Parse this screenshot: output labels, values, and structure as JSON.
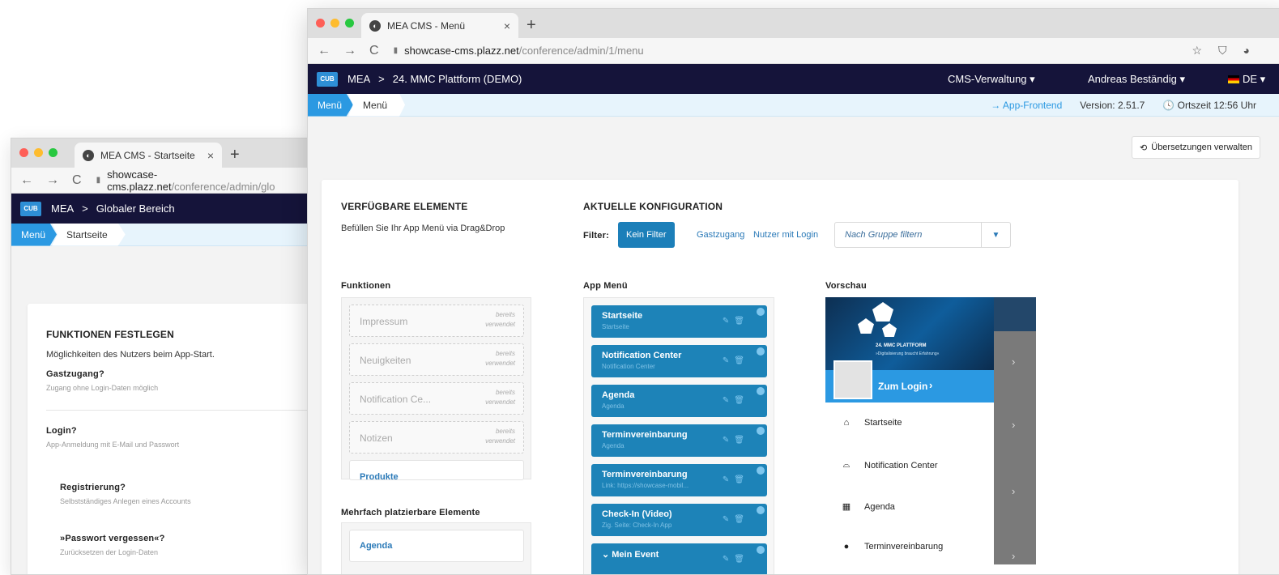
{
  "back_window": {
    "tab_title": "MEA CMS - Startseite",
    "url_host": "showcase-cms.plazz.net",
    "url_path": "/conference/admin/glo",
    "app": {
      "logo": "CUB",
      "crumb_root": "MEA",
      "crumb_sep": ">",
      "crumb_current": "Globaler Bereich"
    },
    "breadcrumb": {
      "active": "Menü",
      "item": "Startseite"
    },
    "section_title": "FUNKTIONEN FESTLEGEN",
    "section_desc": "Möglichkeiten des Nutzers beim App-Start.",
    "options": [
      {
        "label": "Gastzugang?",
        "desc": "Zugang ohne Login-Daten möglich"
      },
      {
        "label": "Login?",
        "desc": "App-Anmeldung mit E-Mail und Passwort"
      },
      {
        "label": "Registrierung?",
        "desc": "Selbstständiges Anlegen eines Accounts"
      },
      {
        "label": "»Passwort vergessen«?",
        "desc": "Zurücksetzen der Login-Daten"
      }
    ]
  },
  "front_window": {
    "tab_title": "MEA CMS - Menü",
    "url_host": "showcase-cms.plazz.net",
    "url_path": "/conference/admin/1/menu",
    "app": {
      "logo": "CUB",
      "crumb_root": "MEA",
      "crumb_sep": ">",
      "crumb_current": "24. MMC Plattform (DEMO)",
      "cms_menu": "CMS-Verwaltung ▾",
      "user_menu": "Andreas Beständig ▾",
      "lang": "DE ▾"
    },
    "breadcrumb": {
      "active": "Menü",
      "item": "Menü",
      "frontend_link": "→ App-Frontend",
      "version": "Version: 2.51.7",
      "time": "🕓 Ortszeit 12:56 Uhr"
    },
    "translations_button": "Übersetzungen verwalten",
    "available": {
      "title": "VERFÜGBARE ELEMENTE",
      "desc": "Befüllen Sie Ihr App Menü via Drag&Drop"
    },
    "config": {
      "title": "AKTUELLE KONFIGURATION",
      "filter_label": "Filter:",
      "filter_active": "Kein Filter",
      "filter_guest": "Gastzugang",
      "filter_login": "Nutzer mit Login",
      "group_placeholder": "Nach Gruppe filtern"
    },
    "functions": {
      "title": "Funktionen",
      "used_line1": "bereits",
      "used_line2": "verwendet",
      "items": [
        "Impressum",
        "Neuigkeiten",
        "Notification Ce...",
        "Notizen"
      ],
      "extra_item": "Produkte"
    },
    "multi": {
      "title": "Mehrfach platzierbare Elemente",
      "first_item": "Agenda"
    },
    "app_menu": {
      "title": "App Menü",
      "items": [
        {
          "title": "Startseite",
          "sub": "Startseite"
        },
        {
          "title": "Notification Center",
          "sub": "Notification Center"
        },
        {
          "title": "Agenda",
          "sub": "Agenda"
        },
        {
          "title": "Terminvereinbarung",
          "sub": "Agenda"
        },
        {
          "title": "Terminvereinbarung",
          "sub": "Link: https://showcase-mobil..."
        },
        {
          "title": "Check-In (Video)",
          "sub": "Zig. Seite: Check-In App"
        },
        {
          "title": "⌄ Mein Event",
          "sub": ""
        }
      ]
    },
    "preview": {
      "title": "Vorschau",
      "banner_title": "24. MMC PLATTFORM",
      "banner_sub": "»Digitalisierung braucht Erfahrung«",
      "login": "Zum Login",
      "rows": [
        {
          "icon": "home-icon",
          "glyph": "⌂",
          "label": "Startseite"
        },
        {
          "icon": "inbox-icon",
          "glyph": "⌓",
          "label": "Notification Center"
        },
        {
          "icon": "calendar-icon",
          "glyph": "▦",
          "label": "Agenda"
        },
        {
          "icon": "chat-icon",
          "glyph": "●",
          "label": "Terminvereinbarung"
        }
      ]
    }
  }
}
